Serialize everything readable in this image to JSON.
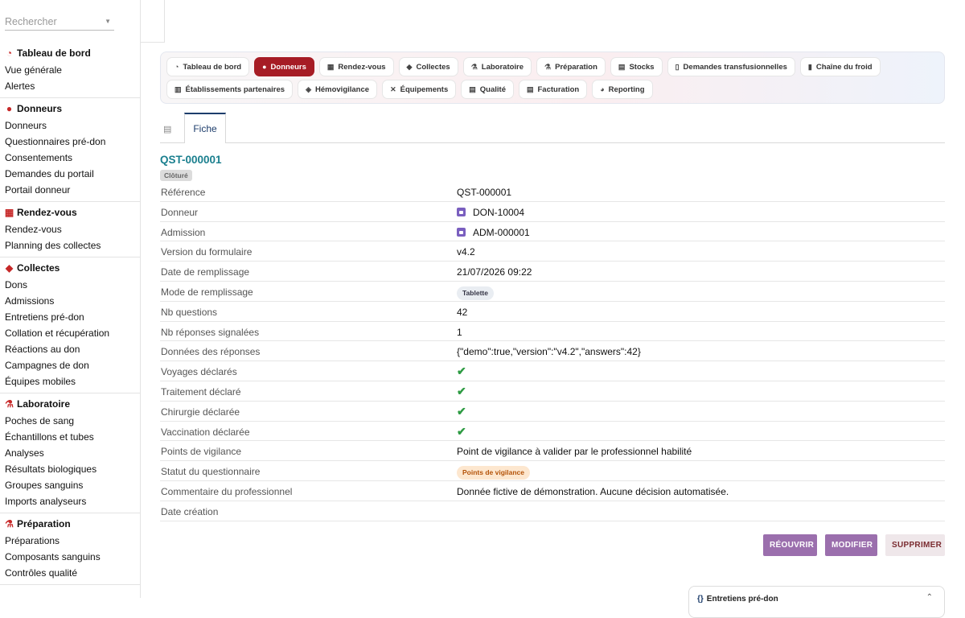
{
  "search": {
    "placeholder": "Rechercher"
  },
  "sidebar": {
    "sections": [
      {
        "title": "Tableau de bord",
        "icon": "gauge-icon",
        "items": [
          "Vue générale",
          "Alertes"
        ]
      },
      {
        "title": "Donneurs",
        "icon": "user-icon",
        "items": [
          "Donneurs",
          "Questionnaires pré-don",
          "Consentements",
          "Demandes du portail",
          "Portail donneur"
        ]
      },
      {
        "title": "Rendez-vous",
        "icon": "calendar-icon",
        "items": [
          "Rendez-vous",
          "Planning des collectes"
        ]
      },
      {
        "title": "Collectes",
        "icon": "drop-icon",
        "items": [
          "Dons",
          "Admissions",
          "Entretiens pré-don",
          "Collation et récupération",
          "Réactions au don",
          "Campagnes de don",
          "Équipes mobiles"
        ]
      },
      {
        "title": "Laboratoire",
        "icon": "microscope-icon",
        "items": [
          "Poches de sang",
          "Échantillons et tubes",
          "Analyses",
          "Résultats biologiques",
          "Groupes sanguins",
          "Imports analyseurs"
        ]
      },
      {
        "title": "Préparation",
        "icon": "flask-icon",
        "items": [
          "Préparations",
          "Composants sanguins",
          "Contrôles qualité"
        ]
      }
    ]
  },
  "modules": {
    "row1": [
      {
        "label": "Tableau de bord",
        "icon": "gauge-icon",
        "glyph": "◔"
      },
      {
        "label": "Donneurs",
        "icon": "user-icon",
        "glyph": "●",
        "active": true
      },
      {
        "label": "Rendez-vous",
        "icon": "calendar-icon",
        "glyph": "▦"
      },
      {
        "label": "Collectes",
        "icon": "drop-icon",
        "glyph": "◆"
      },
      {
        "label": "Laboratoire",
        "icon": "microscope-icon",
        "glyph": "⚗"
      },
      {
        "label": "Préparation",
        "icon": "flask-icon",
        "glyph": "⚗"
      },
      {
        "label": "Stocks",
        "icon": "warehouse-icon",
        "glyph": "▤"
      },
      {
        "label": "Demandes transfusionnelles",
        "icon": "document-icon",
        "glyph": "▯"
      },
      {
        "label": "Chaîne du froid",
        "icon": "thermometer-icon",
        "glyph": "▮"
      }
    ],
    "row2": [
      {
        "label": "Établissements partenaires",
        "icon": "building-icon",
        "glyph": "▥"
      },
      {
        "label": "Hémovigilance",
        "icon": "shield-icon",
        "glyph": "◈"
      },
      {
        "label": "Équipements",
        "icon": "tools-icon",
        "glyph": "✕"
      },
      {
        "label": "Qualité",
        "icon": "clipboard-icon",
        "glyph": "▤"
      },
      {
        "label": "Facturation",
        "icon": "invoice-icon",
        "glyph": "▤"
      },
      {
        "label": "Reporting",
        "icon": "chart-pie-icon",
        "glyph": "◕"
      }
    ]
  },
  "tabs": {
    "list_icon": "list-icon",
    "active": "Fiche"
  },
  "record": {
    "title": "QST-000001",
    "status": "Clôturé",
    "fields": [
      {
        "label": "Référence",
        "value": "QST-000001",
        "kind": "text"
      },
      {
        "label": "Donneur",
        "value": "DON-10004",
        "kind": "link"
      },
      {
        "label": "Admission",
        "value": "ADM-000001",
        "kind": "link"
      },
      {
        "label": "Version du formulaire",
        "value": "v4.2",
        "kind": "text"
      },
      {
        "label": "Date de remplissage",
        "value": "21/07/2026 09:22",
        "kind": "text"
      },
      {
        "label": "Mode de remplissage",
        "value": "Tablette",
        "kind": "pill-grey"
      },
      {
        "label": "Nb questions",
        "value": "42",
        "kind": "text"
      },
      {
        "label": "Nb réponses signalées",
        "value": "1",
        "kind": "text"
      },
      {
        "label": "Données des réponses",
        "value": "{\"demo\":true,\"version\":\"v4.2\",\"answers\":42}",
        "kind": "text"
      },
      {
        "label": "Voyages déclarés",
        "value": "✔",
        "kind": "check"
      },
      {
        "label": "Traitement déclaré",
        "value": "✔",
        "kind": "check"
      },
      {
        "label": "Chirurgie déclarée",
        "value": "✔",
        "kind": "check"
      },
      {
        "label": "Vaccination déclarée",
        "value": "✔",
        "kind": "check"
      },
      {
        "label": "Points de vigilance",
        "value": "Point de vigilance à valider par le professionnel habilité",
        "kind": "text"
      },
      {
        "label": "Statut du questionnaire",
        "value": "Points de vigilance",
        "kind": "pill-orange"
      },
      {
        "label": "Commentaire du professionnel",
        "value": "Donnée fictive de démonstration. Aucune décision automatisée.",
        "kind": "text"
      },
      {
        "label": "Date création",
        "value": "",
        "kind": "text"
      }
    ]
  },
  "actions": {
    "reopen": "RÉOUVRIR",
    "edit": "MODIFIER",
    "delete": "SUPPRIMER"
  },
  "related_panel": {
    "title": "Entretiens pré-don",
    "icon": "code-icon"
  }
}
